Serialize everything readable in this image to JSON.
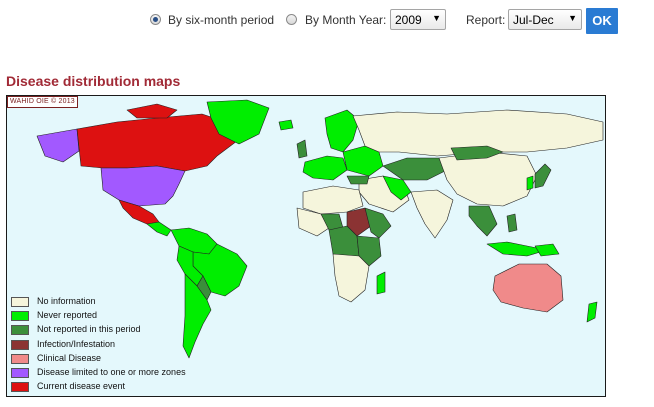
{
  "controls": {
    "period_option_label": "By six-month period",
    "month_option_label": "By Month Year:",
    "year_value": "2009",
    "report_label": "Report:",
    "report_value": "Jul-Dec",
    "ok_label": "OK"
  },
  "section_title": "Disease distribution maps",
  "map": {
    "copyright": "WAHID OIE © 2013",
    "legend": [
      {
        "label": "No information",
        "color": "#f5f5dc"
      },
      {
        "label": "Never reported",
        "color": "#00ee00"
      },
      {
        "label": "Not reported in this period",
        "color": "#3b8f3b"
      },
      {
        "label": "Infection/Infestation",
        "color": "#8b3333"
      },
      {
        "label": "Clinical Disease",
        "color": "#f08a8a"
      },
      {
        "label": "Disease limited to one or more zones",
        "color": "#a259ff"
      },
      {
        "label": "Current disease event",
        "color": "#dd1111"
      }
    ],
    "colors": {
      "ocean": "#e4f8fc",
      "border": "#222222"
    }
  }
}
